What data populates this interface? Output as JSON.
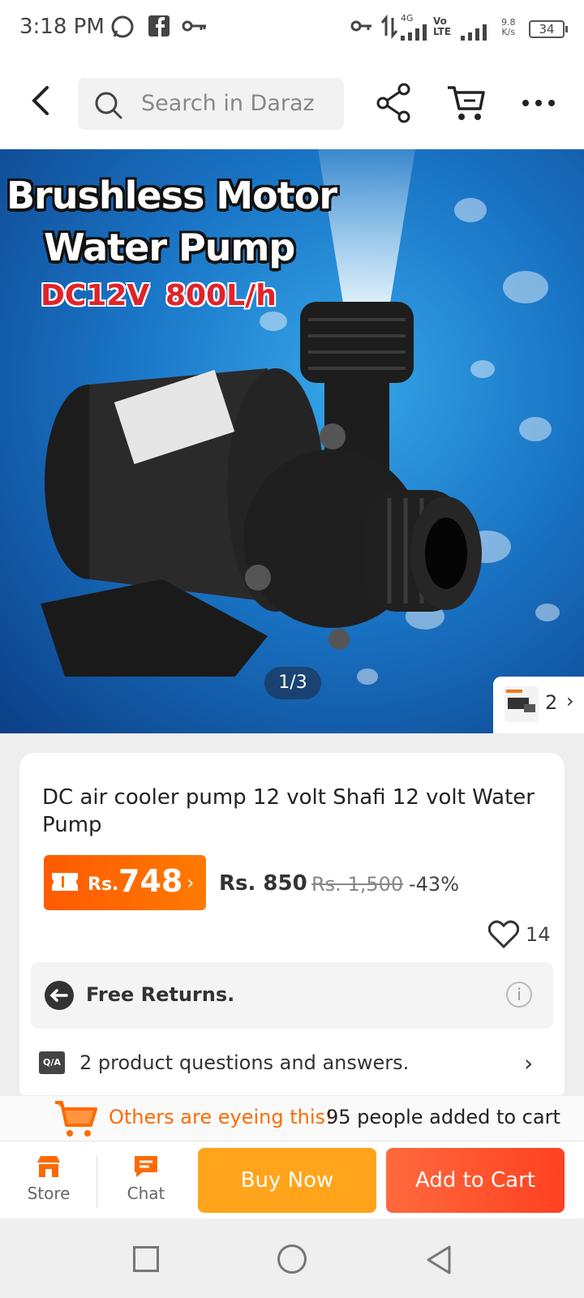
{
  "status_bar": {
    "time": "3:18 PM",
    "net_speed_value": "9.8",
    "net_speed_unit": "K/s",
    "battery": "34",
    "network_1": "4G",
    "network_2": "Vo LTE"
  },
  "header": {
    "search_placeholder": "Search in Daraz"
  },
  "hero": {
    "title_line_1": "Brushless Motor",
    "title_line_2": "Water Pump",
    "spec_voltage": "DC12V",
    "spec_flow": "800L/h",
    "image_counter": "1/3",
    "thumb_count": "2"
  },
  "product": {
    "title": "DC air cooler pump 12 volt Shafi 12 volt Water Pump",
    "flash_currency": "Rs.",
    "flash_price": "748",
    "price_now": "Rs. 850",
    "price_original": "Rs. 1,500",
    "discount": "-43%",
    "wishlist_count": "14",
    "returns_label": "Free Returns.",
    "qa_badge": "Q/A",
    "qa_label": "2 product questions and answers."
  },
  "social_proof": {
    "headline": "Others are eyeing this!",
    "detail": "95 people added to cart"
  },
  "action_bar": {
    "store_label": "Store",
    "chat_label": "Chat",
    "buy_now_label": "Buy Now",
    "add_to_cart_label": "Add to Cart"
  },
  "colors": {
    "brand_orange": "#ff6a00",
    "buy_now": "#ffa41b",
    "add_to_cart": "#ff4a24"
  },
  "icons": [
    "whatsapp-icon",
    "facebook-icon",
    "key-icon",
    "back-icon",
    "search-icon",
    "share-icon",
    "cart-icon",
    "more-icon",
    "heart-icon",
    "returns-icon",
    "info-icon",
    "chevron-right-icon",
    "store-icon",
    "chat-icon"
  ]
}
